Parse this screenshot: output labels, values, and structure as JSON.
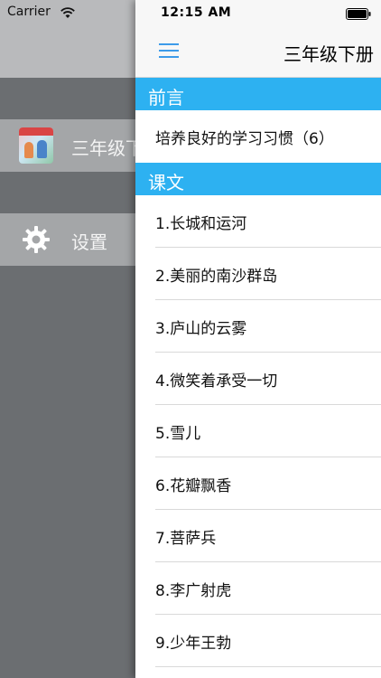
{
  "status_bar": {
    "carrier": "Carrier",
    "time": "12:15 AM"
  },
  "drawer": {
    "items": [
      {
        "label": "三年级下册",
        "icon": "book-cover-icon"
      },
      {
        "label": "设置",
        "icon": "gear-icon"
      }
    ]
  },
  "header": {
    "title": "三年级下册",
    "menu_icon": "hamburger-menu-icon"
  },
  "sections": [
    {
      "title": "前言",
      "items": [
        "培养良好的学习习惯（6）"
      ]
    },
    {
      "title": "课文",
      "items": [
        "1.长城和运河",
        "2.美丽的南沙群岛",
        "3.庐山的云雾",
        "4.微笑着承受一切",
        "5.雪儿",
        "6.花瓣飘香",
        "7.菩萨兵",
        "8.李广射虎",
        "9.少年王勃"
      ]
    }
  ],
  "colors": {
    "accent_blue": "#2db1f1",
    "menu_icon_blue": "#3d9be9",
    "drawer_bg": "#6b6e71",
    "drawer_row_bg": "#a4a6a8"
  }
}
